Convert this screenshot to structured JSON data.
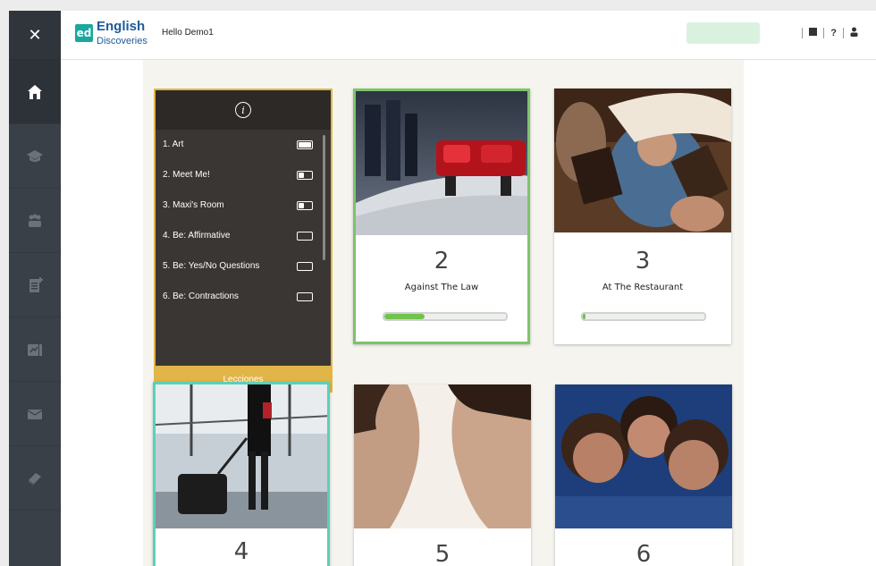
{
  "header": {
    "logo_badge": "ed",
    "logo_line1": "English",
    "logo_line2": "Discoveries",
    "greeting": "Hello Demo1",
    "help_label": "?"
  },
  "rail": {
    "items": [
      "close-icon",
      "home-icon",
      "courses-icon",
      "community-icon",
      "assignment-icon",
      "progress-icon",
      "messages-icon",
      "book-icon"
    ]
  },
  "lessons": {
    "footer_label": "Lecciones",
    "items": [
      {
        "label": "1. Art",
        "progress": 1.0
      },
      {
        "label": "2. Meet Me!",
        "progress": 0.45
      },
      {
        "label": "3. Maxi's Room",
        "progress": 0.45
      },
      {
        "label": "4. Be: Affirmative",
        "progress": 0
      },
      {
        "label": "5. Be: Yes/No Questions",
        "progress": 0
      },
      {
        "label": "6. Be: Contractions",
        "progress": 0
      }
    ]
  },
  "units": [
    {
      "number": "2",
      "title": "Against The Law",
      "progress": 0.33,
      "border": "#7dc36b"
    },
    {
      "number": "3",
      "title": "At The Restaurant",
      "progress": 0.02,
      "border": "#ffffff"
    },
    {
      "number": "4",
      "title": "",
      "border": "#5cd0b8"
    },
    {
      "number": "5",
      "title": "",
      "border": "#ffffff"
    },
    {
      "number": "6",
      "title": "",
      "border": "#ffffff"
    }
  ],
  "colors": {
    "rail": "#3a4048",
    "lessons_bg": "#3a3633",
    "lessons_accent": "#e1b547",
    "progress": "#72c24e"
  }
}
